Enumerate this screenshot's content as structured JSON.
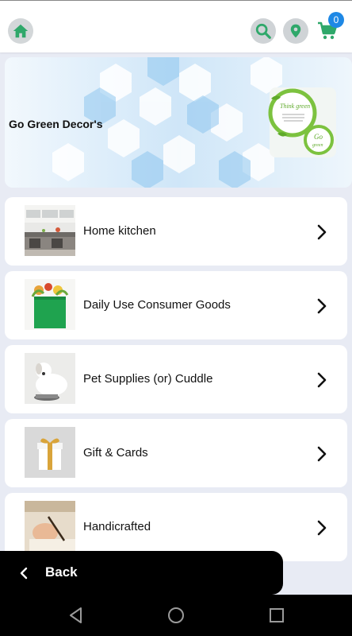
{
  "header": {
    "home_icon": "home-icon",
    "search_icon": "search-icon",
    "location_icon": "location-pin-icon",
    "cart_icon": "cart-icon",
    "cart_count": "0",
    "accent_color": "#2fa86a",
    "badge_color": "#1e88e5"
  },
  "banner": {
    "title": "Go Green Decor's",
    "think_text": "Think green",
    "go_text": "Go",
    "go_sub": "green"
  },
  "categories": [
    {
      "label": "Home kitchen",
      "icon": "kitchen-image"
    },
    {
      "label": "Daily Use Consumer Goods",
      "icon": "grocery-bag-image"
    },
    {
      "label": "Pet Supplies (or) Cuddle",
      "icon": "pet-dog-image"
    },
    {
      "label": "Gift & Cards",
      "icon": "gift-box-image"
    },
    {
      "label": "Handicrafted",
      "icon": "handcraft-image"
    }
  ],
  "footer": {
    "back_label": "Back"
  },
  "system_nav": {
    "back": "triangle-back-icon",
    "home": "circle-home-icon",
    "recents": "square-recents-icon"
  }
}
